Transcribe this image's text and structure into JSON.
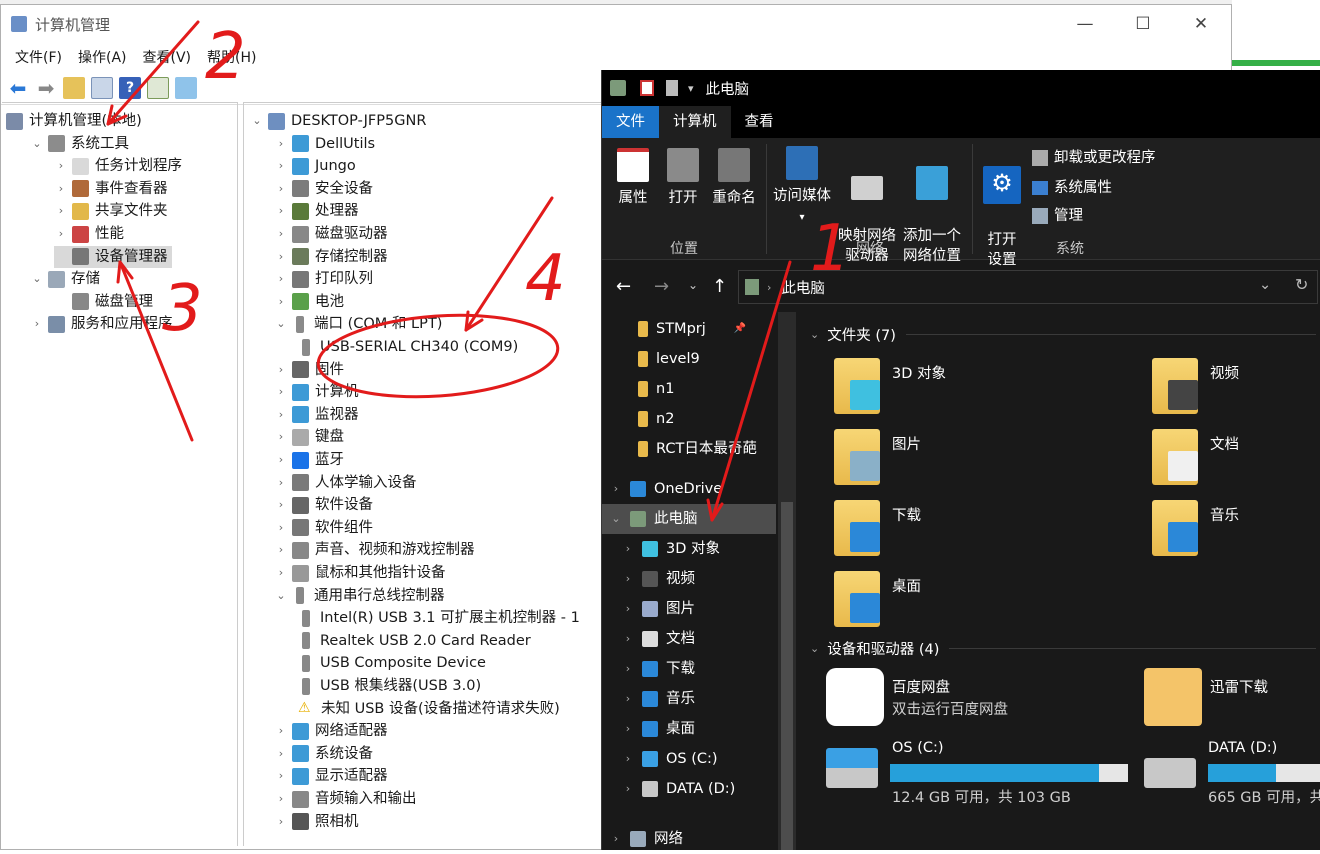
{
  "backdrop": {
    "accent": "#35b047"
  },
  "cm": {
    "title": "计算机管理",
    "menu": [
      "文件(F)",
      "操作(A)",
      "查看(V)",
      "帮助(H)"
    ],
    "left_tree": [
      {
        "label": "计算机管理(本地)",
        "level": 0,
        "icon": "computer-manage-icon"
      },
      {
        "label": "系统工具",
        "level": 1,
        "icon": "tools-icon",
        "expanded": true
      },
      {
        "label": "任务计划程序",
        "level": 2,
        "icon": "clock-icon"
      },
      {
        "label": "事件查看器",
        "level": 2,
        "icon": "event-viewer-icon"
      },
      {
        "label": "共享文件夹",
        "level": 2,
        "icon": "shared-folder-icon"
      },
      {
        "label": "性能",
        "level": 2,
        "icon": "performance-icon"
      },
      {
        "label": "设备管理器",
        "level": 2,
        "icon": "device-manager-icon",
        "selected": true
      },
      {
        "label": "存储",
        "level": 1,
        "icon": "storage-icon",
        "expanded": true
      },
      {
        "label": "磁盘管理",
        "level": 2,
        "icon": "disk-icon"
      },
      {
        "label": "服务和应用程序",
        "level": 1,
        "icon": "services-icon"
      }
    ],
    "device_tree": [
      {
        "label": "DESKTOP-JFP5GNR",
        "level": 0,
        "icon": "computer-icon",
        "expanded": true
      },
      {
        "label": "DellUtils",
        "level": 1,
        "icon": "monitor-icon"
      },
      {
        "label": "Jungo",
        "level": 1,
        "icon": "monitor-icon"
      },
      {
        "label": "安全设备",
        "level": 1,
        "icon": "security-device-icon"
      },
      {
        "label": "处理器",
        "level": 1,
        "icon": "cpu-icon"
      },
      {
        "label": "磁盘驱动器",
        "level": 1,
        "icon": "disk-drive-icon"
      },
      {
        "label": "存储控制器",
        "level": 1,
        "icon": "storage-controller-icon"
      },
      {
        "label": "打印队列",
        "level": 1,
        "icon": "printer-icon"
      },
      {
        "label": "电池",
        "level": 1,
        "icon": "battery-icon"
      },
      {
        "label": "端口 (COM 和 LPT)",
        "level": 1,
        "icon": "port-icon",
        "expanded": true
      },
      {
        "label": "USB-SERIAL CH340 (COM9)",
        "level": 2,
        "icon": "port-icon"
      },
      {
        "label": "固件",
        "level": 1,
        "icon": "firmware-icon"
      },
      {
        "label": "计算机",
        "level": 1,
        "icon": "monitor-icon"
      },
      {
        "label": "监视器",
        "level": 1,
        "icon": "monitor-icon"
      },
      {
        "label": "键盘",
        "level": 1,
        "icon": "keyboard-icon"
      },
      {
        "label": "蓝牙",
        "level": 1,
        "icon": "bluetooth-icon"
      },
      {
        "label": "人体学输入设备",
        "level": 1,
        "icon": "hid-icon"
      },
      {
        "label": "软件设备",
        "level": 1,
        "icon": "software-device-icon"
      },
      {
        "label": "软件组件",
        "level": 1,
        "icon": "software-component-icon"
      },
      {
        "label": "声音、视频和游戏控制器",
        "level": 1,
        "icon": "speaker-icon"
      },
      {
        "label": "鼠标和其他指针设备",
        "level": 1,
        "icon": "mouse-icon"
      },
      {
        "label": "通用串行总线控制器",
        "level": 1,
        "icon": "usb-icon",
        "expanded": true
      },
      {
        "label": "Intel(R) USB 3.1 可扩展主机控制器 - 1",
        "level": 2,
        "icon": "usb-icon"
      },
      {
        "label": "Realtek USB 2.0 Card Reader",
        "level": 2,
        "icon": "usb-icon"
      },
      {
        "label": "USB Composite Device",
        "level": 2,
        "icon": "usb-icon"
      },
      {
        "label": "USB 根集线器(USB 3.0)",
        "level": 2,
        "icon": "usb-icon"
      },
      {
        "label": "未知 USB 设备(设备描述符请求失败)",
        "level": 2,
        "icon": "warning-icon"
      },
      {
        "label": "网络适配器",
        "level": 1,
        "icon": "network-adapter-icon"
      },
      {
        "label": "系统设备",
        "level": 1,
        "icon": "system-device-icon"
      },
      {
        "label": "显示适配器",
        "level": 1,
        "icon": "display-adapter-icon"
      },
      {
        "label": "音频输入和输出",
        "level": 1,
        "icon": "audio-icon"
      },
      {
        "label": "照相机",
        "level": 1,
        "icon": "camera-icon"
      }
    ]
  },
  "explorer": {
    "title": "此电脑",
    "tabs": [
      "文件",
      "计算机",
      "查看"
    ],
    "ribbon": {
      "buttons": [
        {
          "label": "属性",
          "icon": "properties-icon"
        },
        {
          "label": "打开",
          "icon": "open-icon"
        },
        {
          "label": "重命名",
          "icon": "rename-icon"
        },
        {
          "label": "访问媒体",
          "icon": "media-icon",
          "dropdown": true
        },
        {
          "label": "映射网络\n驱动器",
          "icon": "map-drive-icon",
          "dropdown": true
        },
        {
          "label": "添加一个\n网络位置",
          "icon": "network-location-icon"
        },
        {
          "label": "打开\n设置",
          "icon": "settings-gear-icon"
        }
      ],
      "small_buttons": [
        "卸载或更改程序",
        "系统属性",
        "管理"
      ],
      "groups": [
        "位置",
        "网络",
        "系统"
      ]
    },
    "address": "此电脑",
    "nav": [
      {
        "label": "STMprj",
        "icon": "folder-icon",
        "pinned": true
      },
      {
        "label": "level9",
        "icon": "folder-icon"
      },
      {
        "label": "n1",
        "icon": "folder-icon"
      },
      {
        "label": "n2",
        "icon": "folder-icon"
      },
      {
        "label": "RCT日本最奇葩",
        "icon": "folder-icon"
      },
      {
        "label": "OneDrive",
        "icon": "onedrive-icon"
      },
      {
        "label": "此电脑",
        "icon": "this-pc-icon",
        "selected": true
      },
      {
        "label": "3D 对象",
        "icon": "3d-objects-icon"
      },
      {
        "label": "视频",
        "icon": "video-icon"
      },
      {
        "label": "图片",
        "icon": "pictures-icon"
      },
      {
        "label": "文档",
        "icon": "documents-icon"
      },
      {
        "label": "下载",
        "icon": "downloads-icon"
      },
      {
        "label": "音乐",
        "icon": "music-icon"
      },
      {
        "label": "桌面",
        "icon": "desktop-icon"
      },
      {
        "label": "OS (C:)",
        "icon": "drive-c-icon"
      },
      {
        "label": "DATA (D:)",
        "icon": "drive-d-icon"
      },
      {
        "label": "网络",
        "icon": "network-icon"
      }
    ],
    "folders_header": "文件夹 (7)",
    "folders": [
      {
        "label": "3D 对象",
        "icon": "3d-objects-icon"
      },
      {
        "label": "视频",
        "icon": "video-icon"
      },
      {
        "label": "图片",
        "icon": "pictures-icon"
      },
      {
        "label": "文档",
        "icon": "documents-icon"
      },
      {
        "label": "下载",
        "icon": "downloads-icon"
      },
      {
        "label": "音乐",
        "icon": "music-icon"
      },
      {
        "label": "桌面",
        "icon": "desktop-icon"
      }
    ],
    "devices_header": "设备和驱动器 (4)",
    "apps": [
      {
        "label": "百度网盘",
        "sub": "双击运行百度网盘",
        "icon": "baidu-netdisk-icon"
      },
      {
        "label": "迅雷下载",
        "icon": "xunlei-icon"
      }
    ],
    "drives": [
      {
        "label": "OS (C:)",
        "sub": "12.4 GB 可用，共 103 GB",
        "used_fraction": 0.88
      },
      {
        "label": "DATA (D:)",
        "sub": "665 GB 可用，共",
        "used_fraction": 0.6
      }
    ]
  },
  "annotations": [
    "1",
    "2",
    "3",
    "4"
  ]
}
